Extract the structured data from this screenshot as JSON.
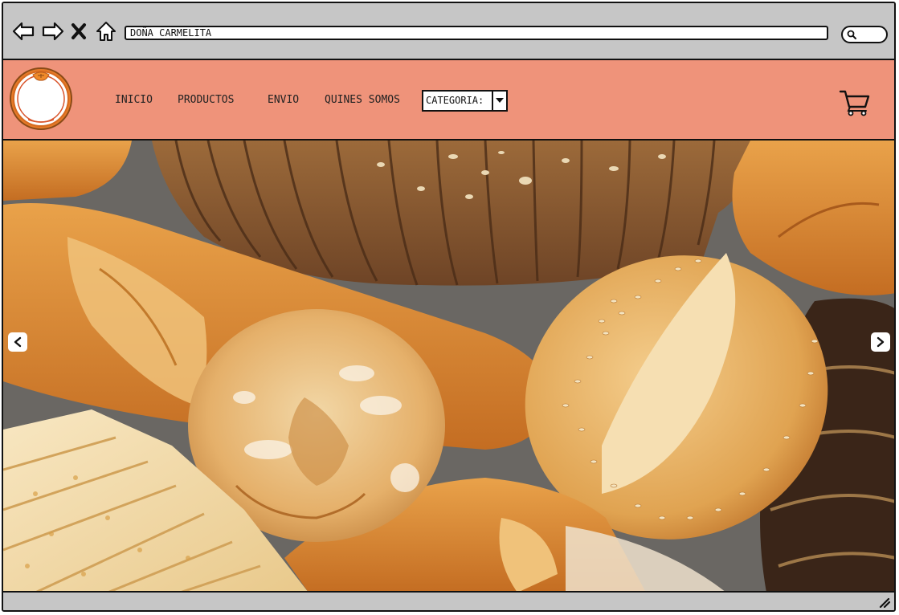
{
  "browser": {
    "address_text": "DOÑA CARMELITA",
    "icons": [
      "back-arrow-icon",
      "forward-arrow-icon",
      "close-icon",
      "home-icon",
      "search-icon"
    ]
  },
  "site": {
    "header_color": "#ef937a",
    "logo": "orange-logo",
    "menu": {
      "inicio": "INICIO",
      "productos": "PRODUCTOS",
      "envio": "ENVIO",
      "quienes": "QUINES SOMOS"
    },
    "category_select": {
      "value": "CATEGORIA:"
    },
    "cart_icon": "shopping-cart-icon"
  },
  "hero": {
    "image": "assorted-bread-loaves-photo",
    "prev_icon": "chevron-left-icon",
    "next_icon": "chevron-right-icon"
  }
}
